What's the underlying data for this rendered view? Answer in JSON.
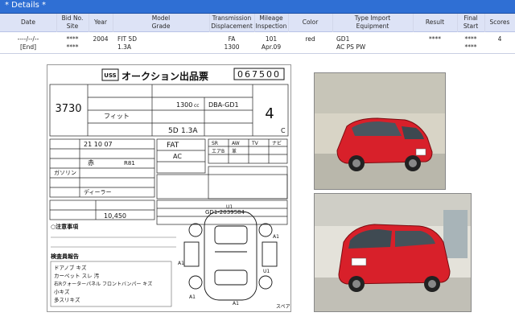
{
  "title": "* Details *",
  "columns": [
    {
      "key": "date",
      "label": "Date"
    },
    {
      "key": "bid",
      "label": "Bid No.\nSite"
    },
    {
      "key": "year",
      "label": "Year"
    },
    {
      "key": "model",
      "label": "Model\nGrade"
    },
    {
      "key": "trans",
      "label": "Transmission\nDisplacement"
    },
    {
      "key": "mileage",
      "label": "Mileage\nInspection"
    },
    {
      "key": "color",
      "label": "Color"
    },
    {
      "key": "type",
      "label": "Type      Import\nEquipment"
    },
    {
      "key": "result",
      "label": "Result"
    },
    {
      "key": "final",
      "label": "Final\nStart"
    },
    {
      "key": "scores",
      "label": "Scores"
    }
  ],
  "row": {
    "date": "----/--/--\n[End]",
    "bid": "****\n****",
    "year": "2004",
    "model": "FIT 5D\n1.3A",
    "trans": "FA\n1300",
    "mileage": "101\nApr.09",
    "color": "red",
    "type": "GD1\nAC PS PW",
    "result": "****",
    "final": "****\n****",
    "scores": "4"
  },
  "sheet": {
    "logo": "USS",
    "heading": "オークション出品票",
    "sheet_no": "067500",
    "lot": "3730",
    "type_code": "DBA-GD1",
    "disp": "1300",
    "cc": "cc",
    "model_name": "フィット",
    "grade": "1.3A",
    "doors": "5D",
    "score": "4",
    "score_sub": "C",
    "shaken": "21 10 07",
    "shift": "FAT",
    "aircon": "AC",
    "chassis": "GD1-2039584",
    "mileage": "10,450",
    "color_jp": "赤",
    "color_code": "R81",
    "fuel": "ガソリン",
    "dealer": "ディーラー",
    "notes_title": "○注意事項",
    "report_title": "検査員報告",
    "report_lines": [
      "ドアノブ キズ",
      "カーペット スレ 汚",
      "右Rクォーターパネル  フロントバンパー キズ",
      "小キズ",
      "多スリキズ"
    ],
    "equip_codes": [
      "SR",
      "AW",
      "TV",
      "ナビ",
      "エアB",
      "革"
    ],
    "misc": "スペア",
    "checks": [
      "U1",
      "A1",
      "A1",
      "U1",
      "A1",
      "A1"
    ]
  },
  "colors": {
    "titlebar": "#2f6fd4",
    "header": "#dde3f6",
    "car": "#d8202a"
  }
}
